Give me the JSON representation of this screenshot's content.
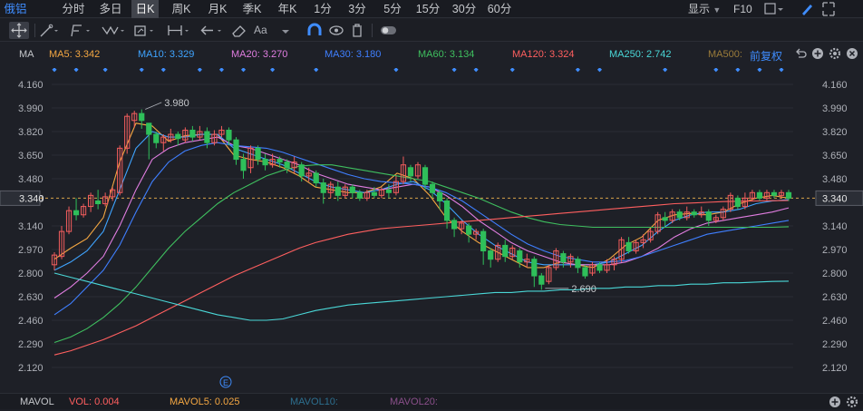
{
  "tabs": [
    {
      "label": "俄铝",
      "state": "first"
    },
    {
      "label": "分时",
      "state": ""
    },
    {
      "label": "多日",
      "state": ""
    },
    {
      "label": "日K",
      "state": "active"
    },
    {
      "label": "周K",
      "state": ""
    },
    {
      "label": "月K",
      "state": ""
    },
    {
      "label": "季K",
      "state": ""
    },
    {
      "label": "年K",
      "state": ""
    },
    {
      "label": "1分",
      "state": ""
    },
    {
      "label": "3分",
      "state": ""
    },
    {
      "label": "5分",
      "state": ""
    },
    {
      "label": "15分",
      "state": ""
    },
    {
      "label": "30分",
      "state": ""
    },
    {
      "label": "60分",
      "state": ""
    }
  ],
  "header_right": {
    "display_label": "显示",
    "f10_label": "F10"
  },
  "toolbar_icons": [
    "crosshair-icon",
    "line-draw-icon",
    "path-draw-icon",
    "wave-draw-icon",
    "rect-draw-icon",
    "range-measure-icon",
    "back-arrow-icon",
    "eraser-icon",
    "text-tool-icon",
    "magnet-icon",
    "eye-icon",
    "trash-icon",
    "toggle-icon"
  ],
  "ma_bar": {
    "label": "MA",
    "items": [
      {
        "text": "MA5: 3.342",
        "color": "#f4a742"
      },
      {
        "text": "MA10: 3.329",
        "color": "#3fa4ff"
      },
      {
        "text": "MA20: 3.270",
        "color": "#e07de0"
      },
      {
        "text": "MA30: 3.180",
        "color": "#3f7fff"
      },
      {
        "text": "MA60: 3.134",
        "color": "#3fbf5f"
      },
      {
        "text": "MA120: 3.324",
        "color": "#ff5f5f"
      },
      {
        "text": "MA250: 2.742",
        "color": "#4ad7d7"
      },
      {
        "text": "MA500:",
        "color": "#9a7b3a"
      }
    ],
    "adjust_label": "前复权"
  },
  "price_axis": {
    "ticks": [
      "4.160",
      "3.990",
      "3.820",
      "3.650",
      "3.480",
      "3.340",
      "3.140",
      "2.970",
      "2.800",
      "2.630",
      "2.460",
      "2.290",
      "2.120"
    ]
  },
  "annotations": {
    "high": "3.980",
    "low": "2.690",
    "current": "3.340",
    "event_marker": "E"
  },
  "mavol_bar": {
    "items": [
      {
        "text": "MAVOL",
        "color": "#c6c8cc"
      },
      {
        "text": "VOL: 0.004",
        "color": "#ff5f5f"
      },
      {
        "text": "MAVOL5: 0.025",
        "color": "#f4a742"
      },
      {
        "text": "MAVOL10:",
        "color": "#2d6f8f"
      },
      {
        "text": "MAVOL20:",
        "color": "#8a4f8a"
      }
    ]
  },
  "chart_data": {
    "type": "candlestick",
    "y_range": [
      2.04,
      4.2
    ],
    "current_price": 3.34,
    "high_label": 3.98,
    "low_label": 2.69,
    "candles": [
      [
        2.86,
        2.93,
        2.82,
        2.95
      ],
      [
        2.92,
        3.1,
        2.9,
        3.14
      ],
      [
        3.1,
        3.25,
        3.08,
        3.28
      ],
      [
        3.25,
        3.22,
        3.18,
        3.34
      ],
      [
        3.22,
        3.28,
        3.2,
        3.3
      ],
      [
        3.28,
        3.36,
        3.24,
        3.38
      ],
      [
        3.32,
        3.3,
        3.26,
        3.4
      ],
      [
        3.3,
        3.35,
        3.28,
        3.38
      ],
      [
        3.35,
        3.4,
        3.32,
        3.42
      ],
      [
        3.38,
        3.7,
        3.36,
        3.72
      ],
      [
        3.7,
        3.93,
        3.66,
        3.95
      ],
      [
        3.9,
        3.95,
        3.85,
        3.97
      ],
      [
        3.95,
        3.9,
        3.84,
        3.98
      ],
      [
        3.88,
        3.8,
        3.62,
        3.86
      ],
      [
        3.8,
        3.74,
        3.7,
        3.82
      ],
      [
        3.74,
        3.78,
        3.68,
        3.8
      ],
      [
        3.76,
        3.8,
        3.74,
        3.84
      ],
      [
        3.8,
        3.77,
        3.72,
        3.82
      ],
      [
        3.76,
        3.83,
        3.74,
        3.85
      ],
      [
        3.83,
        3.78,
        3.75,
        3.86
      ],
      [
        3.78,
        3.82,
        3.76,
        3.86
      ],
      [
        3.82,
        3.74,
        3.7,
        3.85
      ],
      [
        3.74,
        3.8,
        3.72,
        3.83
      ],
      [
        3.8,
        3.83,
        3.78,
        3.86
      ],
      [
        3.83,
        3.76,
        3.72,
        3.85
      ],
      [
        3.76,
        3.62,
        3.58,
        3.78
      ],
      [
        3.62,
        3.54,
        3.48,
        3.66
      ],
      [
        3.56,
        3.7,
        3.52,
        3.72
      ],
      [
        3.7,
        3.62,
        3.58,
        3.72
      ],
      [
        3.62,
        3.58,
        3.54,
        3.66
      ],
      [
        3.58,
        3.62,
        3.56,
        3.66
      ],
      [
        3.62,
        3.6,
        3.56,
        3.64
      ],
      [
        3.6,
        3.56,
        3.52,
        3.62
      ],
      [
        3.56,
        3.6,
        3.52,
        3.64
      ],
      [
        3.58,
        3.5,
        3.46,
        3.6
      ],
      [
        3.5,
        3.52,
        3.46,
        3.56
      ],
      [
        3.52,
        3.45,
        3.42,
        3.54
      ],
      [
        3.45,
        3.38,
        3.3,
        3.48
      ],
      [
        3.38,
        3.44,
        3.34,
        3.46
      ],
      [
        3.42,
        3.36,
        3.32,
        3.46
      ],
      [
        3.36,
        3.42,
        3.34,
        3.44
      ],
      [
        3.42,
        3.38,
        3.34,
        3.44
      ],
      [
        3.38,
        3.34,
        3.32,
        3.4
      ],
      [
        3.34,
        3.38,
        3.32,
        3.4
      ],
      [
        3.38,
        3.36,
        3.34,
        3.42
      ],
      [
        3.36,
        3.4,
        3.34,
        3.42
      ],
      [
        3.4,
        3.38,
        3.34,
        3.44
      ],
      [
        3.38,
        3.46,
        3.36,
        3.5
      ],
      [
        3.46,
        3.58,
        3.44,
        3.64
      ],
      [
        3.56,
        3.5,
        3.46,
        3.58
      ],
      [
        3.5,
        3.58,
        3.48,
        3.6
      ],
      [
        3.56,
        3.44,
        3.4,
        3.58
      ],
      [
        3.44,
        3.38,
        3.34,
        3.46
      ],
      [
        3.38,
        3.32,
        3.26,
        3.4
      ],
      [
        3.32,
        3.18,
        3.12,
        3.34
      ],
      [
        3.18,
        3.12,
        3.06,
        3.2
      ],
      [
        3.12,
        3.16,
        3.08,
        3.18
      ],
      [
        3.14,
        3.08,
        3.02,
        3.16
      ],
      [
        3.08,
        3.1,
        3.04,
        3.12
      ],
      [
        3.1,
        2.96,
        2.86,
        3.12
      ],
      [
        2.96,
        2.9,
        2.84,
        2.98
      ],
      [
        2.9,
        3.0,
        2.88,
        3.02
      ],
      [
        3.0,
        2.92,
        2.88,
        3.04
      ],
      [
        2.92,
        2.98,
        2.9,
        3.0
      ],
      [
        2.96,
        2.88,
        2.84,
        2.98
      ],
      [
        2.88,
        2.9,
        2.84,
        2.94
      ],
      [
        2.9,
        2.78,
        2.7,
        2.92
      ],
      [
        2.78,
        2.72,
        2.68,
        2.8
      ],
      [
        2.74,
        2.84,
        2.72,
        2.86
      ],
      [
        2.84,
        2.96,
        2.82,
        2.98
      ],
      [
        2.94,
        2.88,
        2.84,
        2.96
      ],
      [
        2.88,
        2.92,
        2.84,
        2.94
      ],
      [
        2.9,
        2.84,
        2.8,
        2.92
      ],
      [
        2.84,
        2.78,
        2.76,
        2.86
      ],
      [
        2.8,
        2.86,
        2.78,
        2.88
      ],
      [
        2.86,
        2.82,
        2.8,
        2.88
      ],
      [
        2.82,
        2.86,
        2.8,
        2.9
      ],
      [
        2.86,
        2.9,
        2.82,
        2.92
      ],
      [
        2.9,
        3.04,
        2.88,
        3.06
      ],
      [
        3.02,
        2.96,
        2.94,
        3.06
      ],
      [
        2.96,
        3.02,
        2.94,
        3.04
      ],
      [
        3.02,
        3.04,
        2.98,
        3.08
      ],
      [
        3.04,
        3.1,
        3.02,
        3.12
      ],
      [
        3.1,
        3.22,
        3.08,
        3.24
      ],
      [
        3.2,
        3.18,
        3.14,
        3.24
      ],
      [
        3.18,
        3.24,
        3.16,
        3.26
      ],
      [
        3.24,
        3.2,
        3.18,
        3.26
      ],
      [
        3.2,
        3.24,
        3.18,
        3.28
      ],
      [
        3.24,
        3.22,
        3.2,
        3.26
      ],
      [
        3.22,
        3.24,
        3.2,
        3.28
      ],
      [
        3.24,
        3.18,
        3.14,
        3.26
      ],
      [
        3.18,
        3.2,
        3.16,
        3.22
      ],
      [
        3.2,
        3.26,
        3.18,
        3.28
      ],
      [
        3.26,
        3.36,
        3.24,
        3.38
      ],
      [
        3.34,
        3.28,
        3.26,
        3.36
      ],
      [
        3.28,
        3.34,
        3.26,
        3.38
      ],
      [
        3.34,
        3.38,
        3.32,
        3.4
      ],
      [
        3.38,
        3.34,
        3.32,
        3.4
      ],
      [
        3.34,
        3.38,
        3.32,
        3.4
      ],
      [
        3.38,
        3.36,
        3.34,
        3.4
      ],
      [
        3.36,
        3.38,
        3.34,
        3.4
      ],
      [
        3.38,
        3.34,
        3.32,
        3.4
      ]
    ],
    "ma_series": [
      {
        "name": "MA5",
        "color": "#f4a742",
        "values": [
          2.9,
          2.98,
          3.05,
          3.2,
          3.6,
          3.88,
          3.86,
          3.75,
          3.79,
          3.8,
          3.8,
          3.65,
          3.62,
          3.6,
          3.56,
          3.5,
          3.42,
          3.4,
          3.38,
          3.38,
          3.42,
          3.52,
          3.48,
          3.36,
          3.2,
          3.1,
          3.02,
          2.96,
          2.9,
          2.84,
          2.84,
          2.88,
          2.86,
          2.84,
          2.9,
          3.0,
          3.06,
          3.18,
          3.22,
          3.23,
          3.22,
          3.24,
          3.3,
          3.34,
          3.36,
          3.34
        ]
      },
      {
        "name": "MA10",
        "color": "#3fa4ff",
        "values": [
          2.82,
          2.88,
          2.96,
          3.1,
          3.4,
          3.7,
          3.82,
          3.78,
          3.78,
          3.8,
          3.8,
          3.7,
          3.66,
          3.62,
          3.58,
          3.52,
          3.46,
          3.42,
          3.4,
          3.38,
          3.4,
          3.44,
          3.46,
          3.4,
          3.3,
          3.18,
          3.08,
          3.0,
          2.94,
          2.88,
          2.86,
          2.86,
          2.86,
          2.86,
          2.88,
          2.94,
          3.0,
          3.1,
          3.18,
          3.22,
          3.24,
          3.24,
          3.26,
          3.3,
          3.32,
          3.33
        ]
      },
      {
        "name": "MA20",
        "color": "#e07de0",
        "values": [
          2.62,
          2.7,
          2.8,
          2.92,
          3.14,
          3.4,
          3.62,
          3.7,
          3.74,
          3.76,
          3.78,
          3.72,
          3.7,
          3.66,
          3.62,
          3.58,
          3.52,
          3.48,
          3.44,
          3.42,
          3.4,
          3.42,
          3.44,
          3.42,
          3.36,
          3.28,
          3.18,
          3.1,
          3.02,
          2.96,
          2.92,
          2.88,
          2.86,
          2.86,
          2.86,
          2.88,
          2.92,
          2.98,
          3.06,
          3.12,
          3.16,
          3.18,
          3.2,
          3.22,
          3.24,
          3.27
        ]
      },
      {
        "name": "MA30",
        "color": "#3f7fff",
        "values": [
          2.5,
          2.58,
          2.7,
          2.82,
          3.0,
          3.24,
          3.46,
          3.6,
          3.68,
          3.72,
          3.74,
          3.72,
          3.71,
          3.7,
          3.67,
          3.63,
          3.59,
          3.55,
          3.51,
          3.48,
          3.46,
          3.45,
          3.44,
          3.42,
          3.38,
          3.32,
          3.24,
          3.16,
          3.08,
          3.01,
          2.96,
          2.92,
          2.9,
          2.88,
          2.88,
          2.89,
          2.92,
          2.96,
          3.0,
          3.04,
          3.08,
          3.1,
          3.12,
          3.14,
          3.16,
          3.18
        ]
      },
      {
        "name": "MA60",
        "color": "#3fbf5f",
        "values": [
          2.3,
          2.34,
          2.4,
          2.48,
          2.58,
          2.7,
          2.84,
          2.98,
          3.1,
          3.2,
          3.3,
          3.38,
          3.44,
          3.5,
          3.54,
          3.57,
          3.58,
          3.58,
          3.56,
          3.54,
          3.52,
          3.5,
          3.48,
          3.46,
          3.42,
          3.38,
          3.34,
          3.29,
          3.24,
          3.2,
          3.17,
          3.15,
          3.14,
          3.13,
          3.13,
          3.13,
          3.13,
          3.13,
          3.13,
          3.13,
          3.13,
          3.13,
          3.13,
          3.13,
          3.13,
          3.134
        ]
      },
      {
        "name": "MA120",
        "color": "#ff5f5f",
        "values": [
          2.21,
          2.24,
          2.28,
          2.32,
          2.37,
          2.42,
          2.48,
          2.54,
          2.6,
          2.66,
          2.72,
          2.78,
          2.83,
          2.88,
          2.93,
          2.98,
          3.02,
          3.05,
          3.08,
          3.1,
          3.12,
          3.13,
          3.14,
          3.15,
          3.16,
          3.17,
          3.18,
          3.19,
          3.2,
          3.21,
          3.22,
          3.23,
          3.24,
          3.25,
          3.26,
          3.27,
          3.28,
          3.29,
          3.3,
          3.305,
          3.31,
          3.315,
          3.318,
          3.32,
          3.322,
          3.324
        ]
      },
      {
        "name": "MA250",
        "color": "#4ad7d7",
        "values": [
          2.8,
          2.77,
          2.74,
          2.71,
          2.68,
          2.65,
          2.62,
          2.59,
          2.56,
          2.53,
          2.5,
          2.48,
          2.46,
          2.46,
          2.47,
          2.5,
          2.53,
          2.55,
          2.57,
          2.58,
          2.59,
          2.6,
          2.61,
          2.62,
          2.63,
          2.64,
          2.65,
          2.66,
          2.66,
          2.67,
          2.67,
          2.68,
          2.68,
          2.69,
          2.69,
          2.7,
          2.7,
          2.71,
          2.71,
          2.72,
          2.72,
          2.73,
          2.73,
          2.735,
          2.74,
          2.742
        ]
      }
    ],
    "markers_top": [
      0,
      3,
      7,
      12,
      15,
      20,
      23,
      26,
      30,
      36,
      47,
      55,
      58,
      63,
      72,
      75,
      84,
      91,
      94,
      97,
      100
    ]
  }
}
